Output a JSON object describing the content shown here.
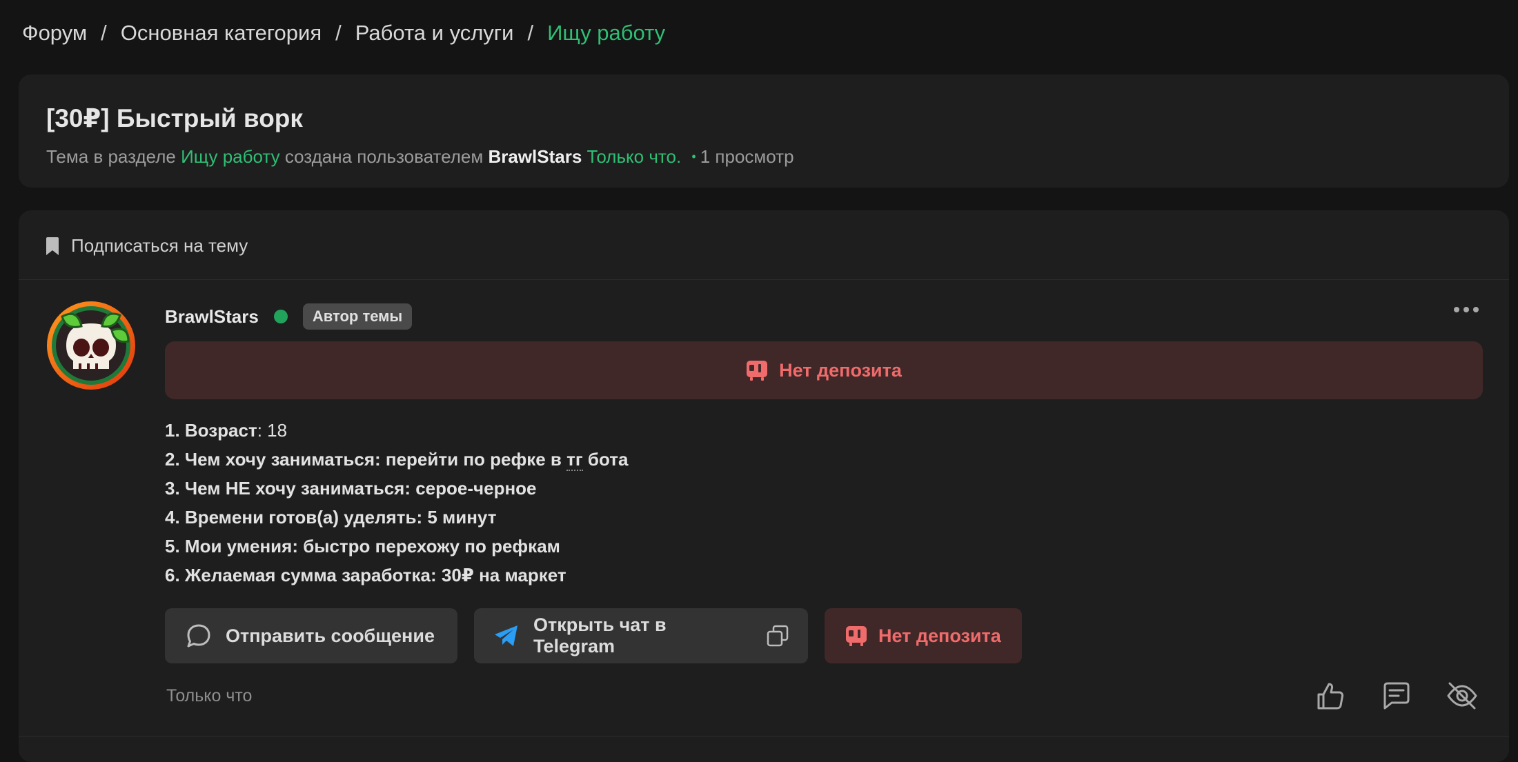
{
  "breadcrumb": {
    "items": [
      "Форум",
      "Основная категория",
      "Работа и услуги"
    ],
    "current": "Ищу работу",
    "separator": "/"
  },
  "thread": {
    "title": "[30₽] Быстрый ворк",
    "meta_prefix": "Тема в разделе",
    "section": "Ищу работу",
    "meta_created_by": "создана пользователем",
    "author": "BrawlStars",
    "created": "Только что.",
    "views": "1 просмотр"
  },
  "subscribe": {
    "label": "Подписаться на тему",
    "icon": "bookmark-icon"
  },
  "post": {
    "username": "BrawlStars",
    "badge": "Автор темы",
    "deposit_notice": "Нет депозита",
    "lines": [
      {
        "label": "1. Возраст",
        "value": ": 18"
      },
      {
        "label": "2. Чем хочу заниматься: перейти по рефке в ",
        "tg": "тг",
        "rest": " бота"
      },
      {
        "label": "3. Чем НЕ хочу заниматься: серое-черное"
      },
      {
        "label": "4. Времени готов(а) уделять: 5 минут"
      },
      {
        "label": "5. Мои умения: быстро перехожу по рефкам"
      },
      {
        "label": "6. Желаемая сумма заработка: 30₽ на маркет"
      }
    ],
    "time": "Только что"
  },
  "actions": {
    "send_message": "Отправить сообщение",
    "telegram": "Открыть чат в Telegram",
    "no_deposit": "Нет депозита"
  },
  "colors": {
    "accent_green": "#2fbf74",
    "deposit_red": "#f06b6b",
    "deposit_bg": "#412828",
    "card_bg": "#1e1e1e",
    "page_bg": "#141414"
  }
}
